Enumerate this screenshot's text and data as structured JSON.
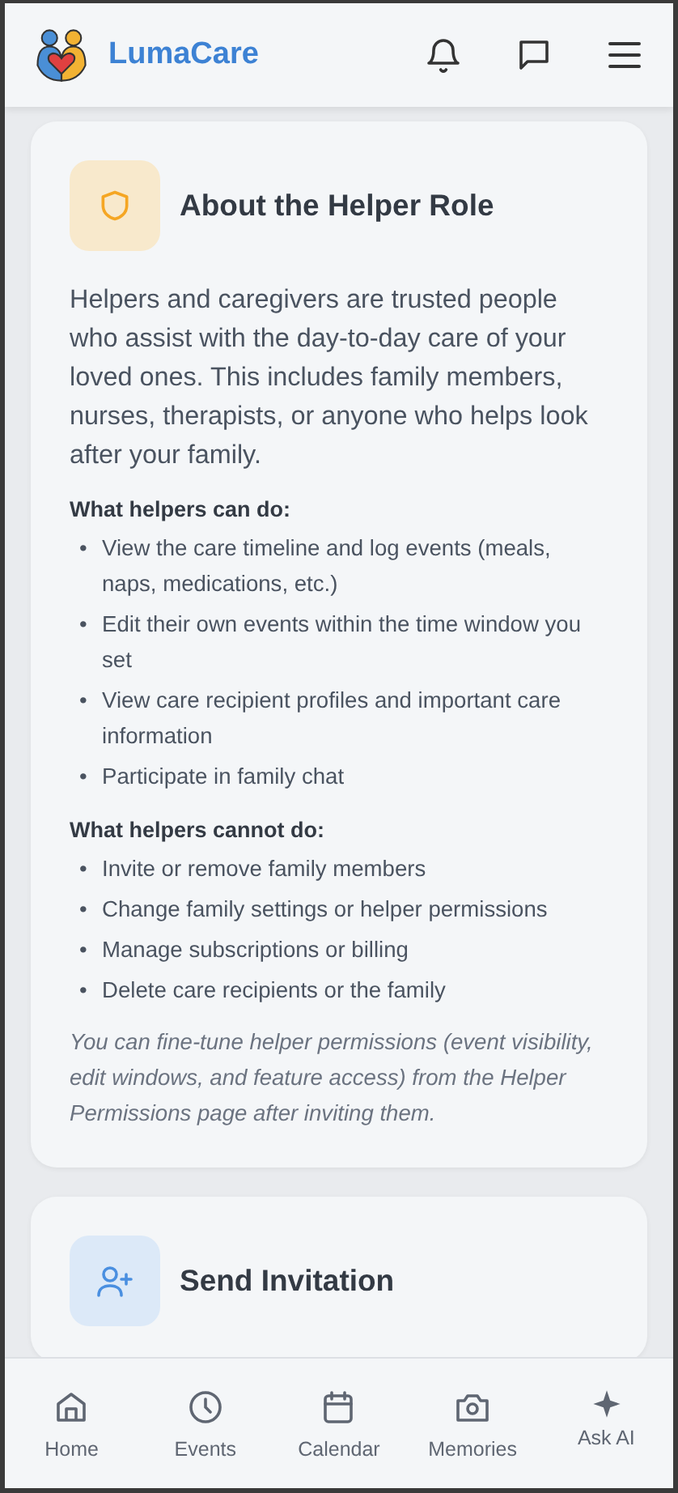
{
  "header": {
    "brand": "LumaCare"
  },
  "cards": [
    {
      "kind": "about",
      "title": "About the Helper Role",
      "intro": "Helpers and caregivers are trusted people who assist with the day-to-day care of your loved ones. This includes family members, nurses, therapists, or anyone who helps look after your family.",
      "sections": [
        {
          "heading": "What helpers can do:",
          "marker": "•",
          "items": [
            "View the care timeline and log events (meals, naps, medications, etc.)",
            "Edit their own events within the time window you set",
            "View care recipient profiles and important care information",
            "Participate in family chat"
          ]
        },
        {
          "heading": "What helpers cannot do:",
          "marker": "•",
          "items": [
            "Invite or remove family members",
            "Change family settings or helper permissions",
            "Manage subscriptions or billing",
            "Delete care recipients or the family"
          ]
        }
      ],
      "note": "You can fine-tune helper permissions (event visibility, edit windows, and feature access) from the Helper Permissions page after inviting them."
    },
    {
      "kind": "invite",
      "title": "Send Invitation"
    }
  ],
  "nav": [
    {
      "kind": "home",
      "label": "Home",
      "selected": false
    },
    {
      "kind": "events",
      "label": "Events",
      "selected": false
    },
    {
      "kind": "calendar",
      "label": "Calendar",
      "selected": false
    },
    {
      "kind": "memories",
      "label": "Memories",
      "selected": false
    },
    {
      "kind": "ai",
      "label": "Ask AI",
      "selected": false
    }
  ]
}
